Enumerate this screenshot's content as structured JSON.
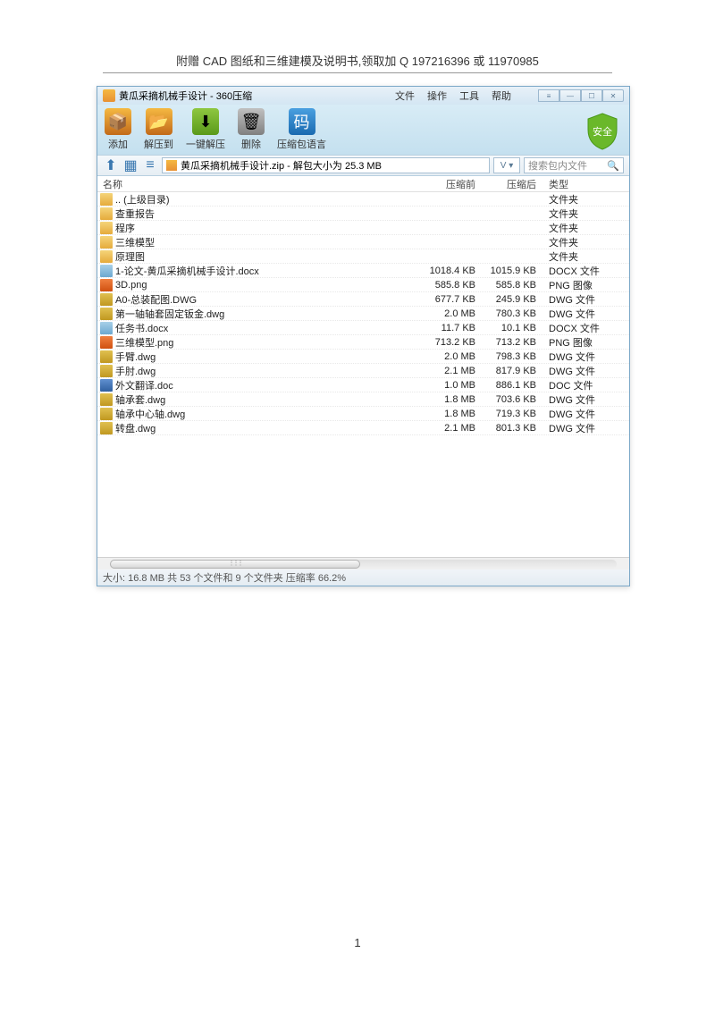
{
  "page_header": "附赠 CAD 图纸和三维建模及说明书,领取加 Q 197216396  或  11970985",
  "page_number": "1",
  "titlebar": {
    "title": "黄瓜采摘机械手设计 - 360压缩",
    "menus": [
      "文件",
      "操作",
      "工具",
      "帮助"
    ]
  },
  "toolbar": {
    "buttons": [
      {
        "label": "添加",
        "name": "add-button"
      },
      {
        "label": "解压到",
        "name": "extract-to-button"
      },
      {
        "label": "一键解压",
        "name": "one-click-extract-button"
      },
      {
        "label": "删除",
        "name": "delete-button"
      },
      {
        "label": "压缩包语言",
        "name": "archive-lang-button"
      }
    ],
    "safety_label": "安全"
  },
  "path": "黄瓜采摘机械手设计.zip - 解包大小为 25.3 MB",
  "search_placeholder": "搜索包内文件",
  "columns": {
    "name": "名称",
    "size_before": "压缩前",
    "size_after": "压缩后",
    "type": "类型"
  },
  "files": [
    {
      "icon": "folder",
      "name": ".. (上级目录)",
      "sb": "",
      "sa": "",
      "type": "文件夹"
    },
    {
      "icon": "folder",
      "name": "查重报告",
      "sb": "",
      "sa": "",
      "type": "文件夹"
    },
    {
      "icon": "folder",
      "name": "程序",
      "sb": "",
      "sa": "",
      "type": "文件夹"
    },
    {
      "icon": "folder",
      "name": "三维模型",
      "sb": "",
      "sa": "",
      "type": "文件夹"
    },
    {
      "icon": "folder",
      "name": "原理图",
      "sb": "",
      "sa": "",
      "type": "文件夹"
    },
    {
      "icon": "docx",
      "name": "1-论文-黄瓜采摘机械手设计.docx",
      "sb": "1018.4 KB",
      "sa": "1015.9 KB",
      "type": "DOCX 文件"
    },
    {
      "icon": "png",
      "name": "3D.png",
      "sb": "585.8 KB",
      "sa": "585.8 KB",
      "type": "PNG 图像"
    },
    {
      "icon": "dwg",
      "name": "A0-总装配图.DWG",
      "sb": "677.7 KB",
      "sa": "245.9 KB",
      "type": "DWG 文件"
    },
    {
      "icon": "dwg",
      "name": "第一轴轴套固定钣金.dwg",
      "sb": "2.0 MB",
      "sa": "780.3 KB",
      "type": "DWG 文件"
    },
    {
      "icon": "docx",
      "name": "任务书.docx",
      "sb": "11.7 KB",
      "sa": "10.1 KB",
      "type": "DOCX 文件"
    },
    {
      "icon": "png",
      "name": "三维模型.png",
      "sb": "713.2 KB",
      "sa": "713.2 KB",
      "type": "PNG 图像"
    },
    {
      "icon": "dwg",
      "name": "手臂.dwg",
      "sb": "2.0 MB",
      "sa": "798.3 KB",
      "type": "DWG 文件"
    },
    {
      "icon": "dwg",
      "name": "手肘.dwg",
      "sb": "2.1 MB",
      "sa": "817.9 KB",
      "type": "DWG 文件"
    },
    {
      "icon": "doc",
      "name": "外文翻译.doc",
      "sb": "1.0 MB",
      "sa": "886.1 KB",
      "type": "DOC 文件"
    },
    {
      "icon": "dwg",
      "name": "轴承套.dwg",
      "sb": "1.8 MB",
      "sa": "703.6 KB",
      "type": "DWG 文件"
    },
    {
      "icon": "dwg",
      "name": "轴承中心轴.dwg",
      "sb": "1.8 MB",
      "sa": "719.3 KB",
      "type": "DWG 文件"
    },
    {
      "icon": "dwg",
      "name": "转盘.dwg",
      "sb": "2.1 MB",
      "sa": "801.3 KB",
      "type": "DWG 文件"
    }
  ],
  "status": "大小: 16.8 MB 共 53 个文件和 9 个文件夹 压缩率 66.2%"
}
